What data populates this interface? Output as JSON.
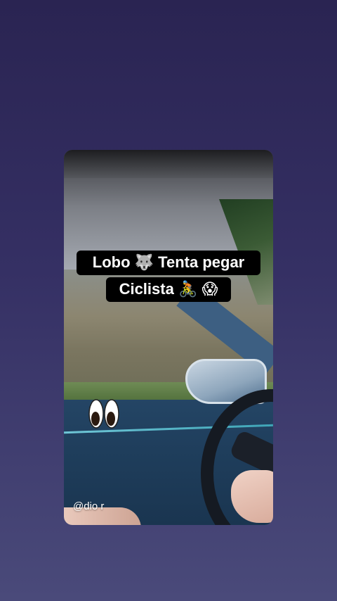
{
  "story": {
    "caption_line1_text": "Lobo",
    "caption_line1_emoji": "🐺",
    "caption_line1_rest": "Tenta pegar",
    "caption_line2_text": "Ciclista",
    "caption_line2_emoji1": "🚴",
    "caption_line2_emoji2": "😱",
    "watermark": "@dio r"
  },
  "icons": {
    "eyes_sticker": "eyes-icon"
  }
}
